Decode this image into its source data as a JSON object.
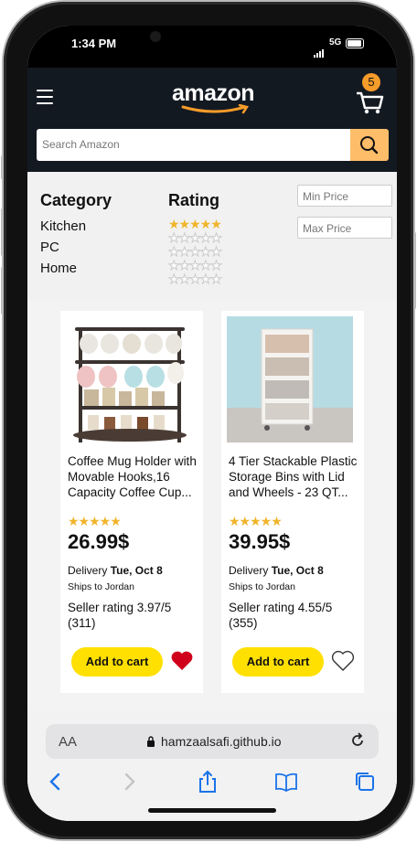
{
  "status_bar": {
    "time": "1:34 PM",
    "network": "5G"
  },
  "header": {
    "logo": "amazon",
    "cart_count": "5"
  },
  "search": {
    "placeholder": "Search Amazon"
  },
  "filters": {
    "category_title": "Category",
    "categories": [
      "Kitchen",
      "PC",
      "Home"
    ],
    "rating_title": "Rating",
    "min_price_placeholder": "Min Price",
    "max_price_placeholder": "Max Price"
  },
  "products": [
    {
      "title": "Coffee Mug Holder with Movable Hooks,16 Capacity Coffee Cup...",
      "stars": "★★★★★",
      "price": "26.99$",
      "delivery_prefix": "Delivery ",
      "delivery_date": "Tue, Oct 8",
      "ships": "Ships to Jordan",
      "seller": "Seller rating 3.97/5 (311)",
      "add_to_cart": "Add to cart",
      "favorited": true
    },
    {
      "title": "4 Tier Stackable Plastic Storage Bins with Lid and Wheels - 23 QT...",
      "stars": "★★★★★",
      "price": "39.95$",
      "delivery_prefix": "Delivery ",
      "delivery_date": "Tue, Oct 8",
      "ships": "Ships to Jordan",
      "seller": "Seller rating 4.55/5 (355)",
      "add_to_cart": "Add to cart",
      "favorited": false
    }
  ],
  "browser": {
    "aa": "AA",
    "url": "hamzaalsafi.github.io"
  },
  "colors": {
    "header_bg": "#131921",
    "search_button": "#febd69",
    "cart_badge": "#f69c2a",
    "add_to_cart": "#ffe000",
    "star": "#f0b42a",
    "heart_active": "#d0021b",
    "nav_active": "#1a73e8"
  }
}
